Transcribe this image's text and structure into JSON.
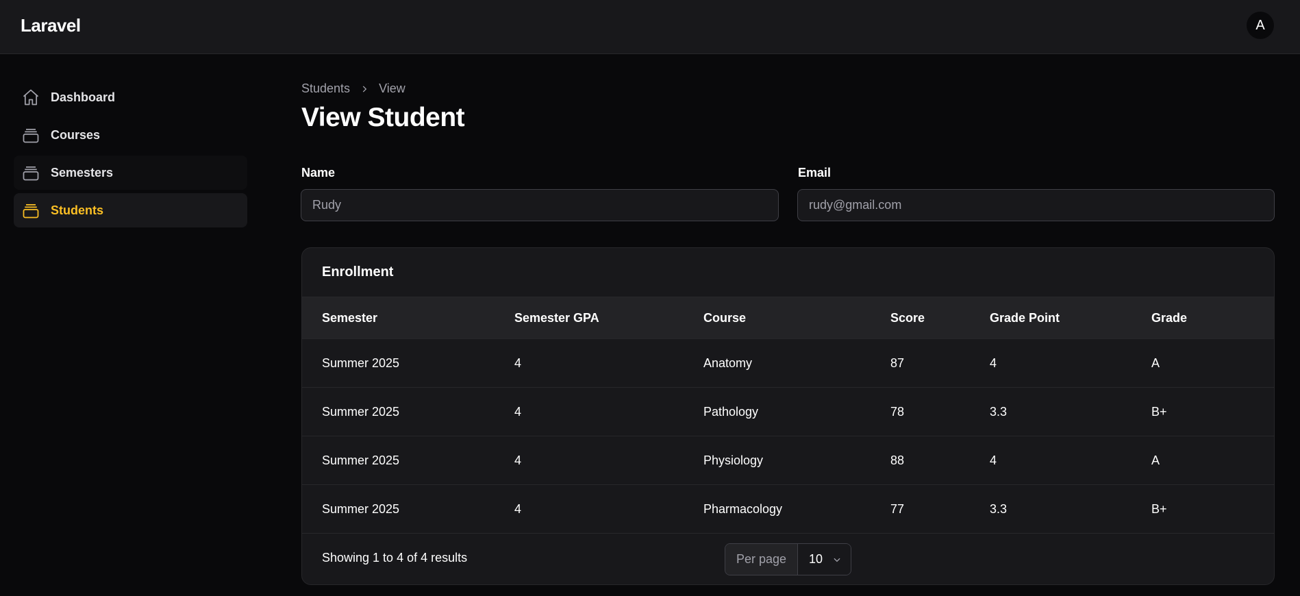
{
  "app": {
    "brand": "Laravel",
    "avatar_initial": "A",
    "accent_color": "#fbbf24"
  },
  "sidebar": {
    "items": [
      {
        "label": "Dashboard",
        "icon": "home-icon",
        "active": false
      },
      {
        "label": "Courses",
        "icon": "stack-icon",
        "active": false
      },
      {
        "label": "Semesters",
        "icon": "stack-icon",
        "active": false
      },
      {
        "label": "Students",
        "icon": "stack-icon",
        "active": true
      }
    ]
  },
  "breadcrumb": {
    "items": [
      "Students",
      "View"
    ]
  },
  "page": {
    "title": "View Student"
  },
  "form": {
    "name": {
      "label": "Name",
      "value": "Rudy"
    },
    "email": {
      "label": "Email",
      "value": "rudy@gmail.com"
    }
  },
  "enrollment": {
    "title": "Enrollment",
    "columns": [
      "Semester",
      "Semester GPA",
      "Course",
      "Score",
      "Grade Point",
      "Grade"
    ],
    "rows": [
      [
        "Summer 2025",
        "4",
        "Anatomy",
        "87",
        "4",
        "A"
      ],
      [
        "Summer 2025",
        "4",
        "Pathology",
        "78",
        "3.3",
        "B+"
      ],
      [
        "Summer 2025",
        "4",
        "Physiology",
        "88",
        "4",
        "A"
      ],
      [
        "Summer 2025",
        "4",
        "Pharmacology",
        "77",
        "3.3",
        "B+"
      ]
    ],
    "results_text": "Showing 1 to 4 of 4 results",
    "per_page_label": "Per page",
    "per_page_value": "10"
  }
}
